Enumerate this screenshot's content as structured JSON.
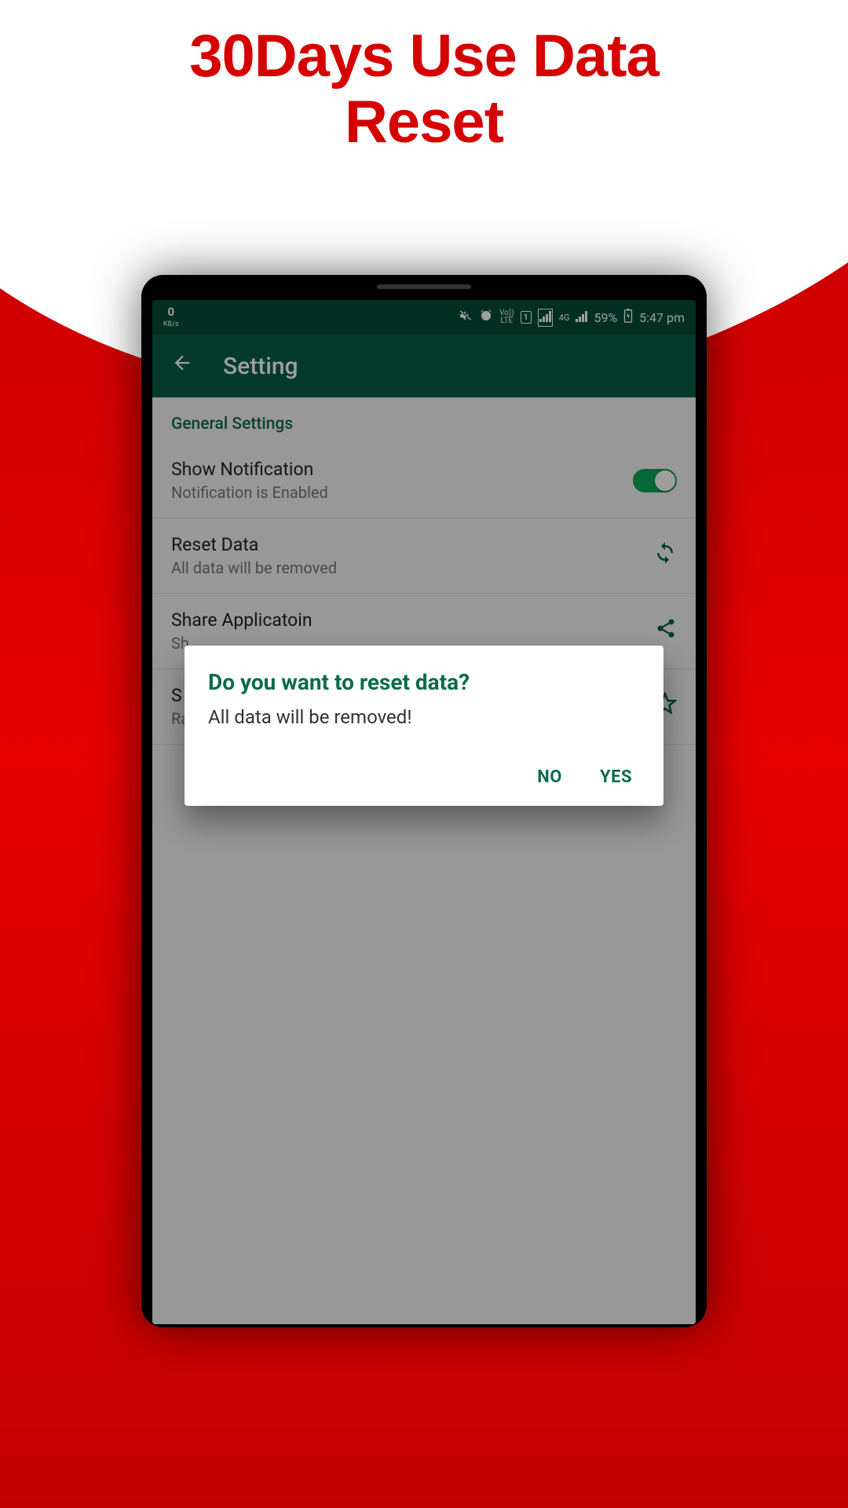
{
  "promo": {
    "line1": "30Days Use Data",
    "line2": "Reset"
  },
  "status": {
    "speed_num": "0",
    "speed_unit": "KB/s",
    "lte": "Vo\nLTE",
    "net": "4G",
    "battery": "59%",
    "time": "5:47 pm",
    "sim": "1"
  },
  "appbar": {
    "title": "Setting"
  },
  "section": {
    "general": "General Settings"
  },
  "rows": {
    "notif": {
      "title": "Show Notification",
      "sub": "Notification is Enabled"
    },
    "reset": {
      "title": "Reset Data",
      "sub": "All data will be removed"
    },
    "share": {
      "title": "Share Applicatoin",
      "sub": "Sh"
    },
    "rate": {
      "title": "S",
      "sub": "Ra"
    }
  },
  "dialog": {
    "title": "Do you want to reset data?",
    "body": "All data will be removed!",
    "no": "NO",
    "yes": "YES"
  }
}
